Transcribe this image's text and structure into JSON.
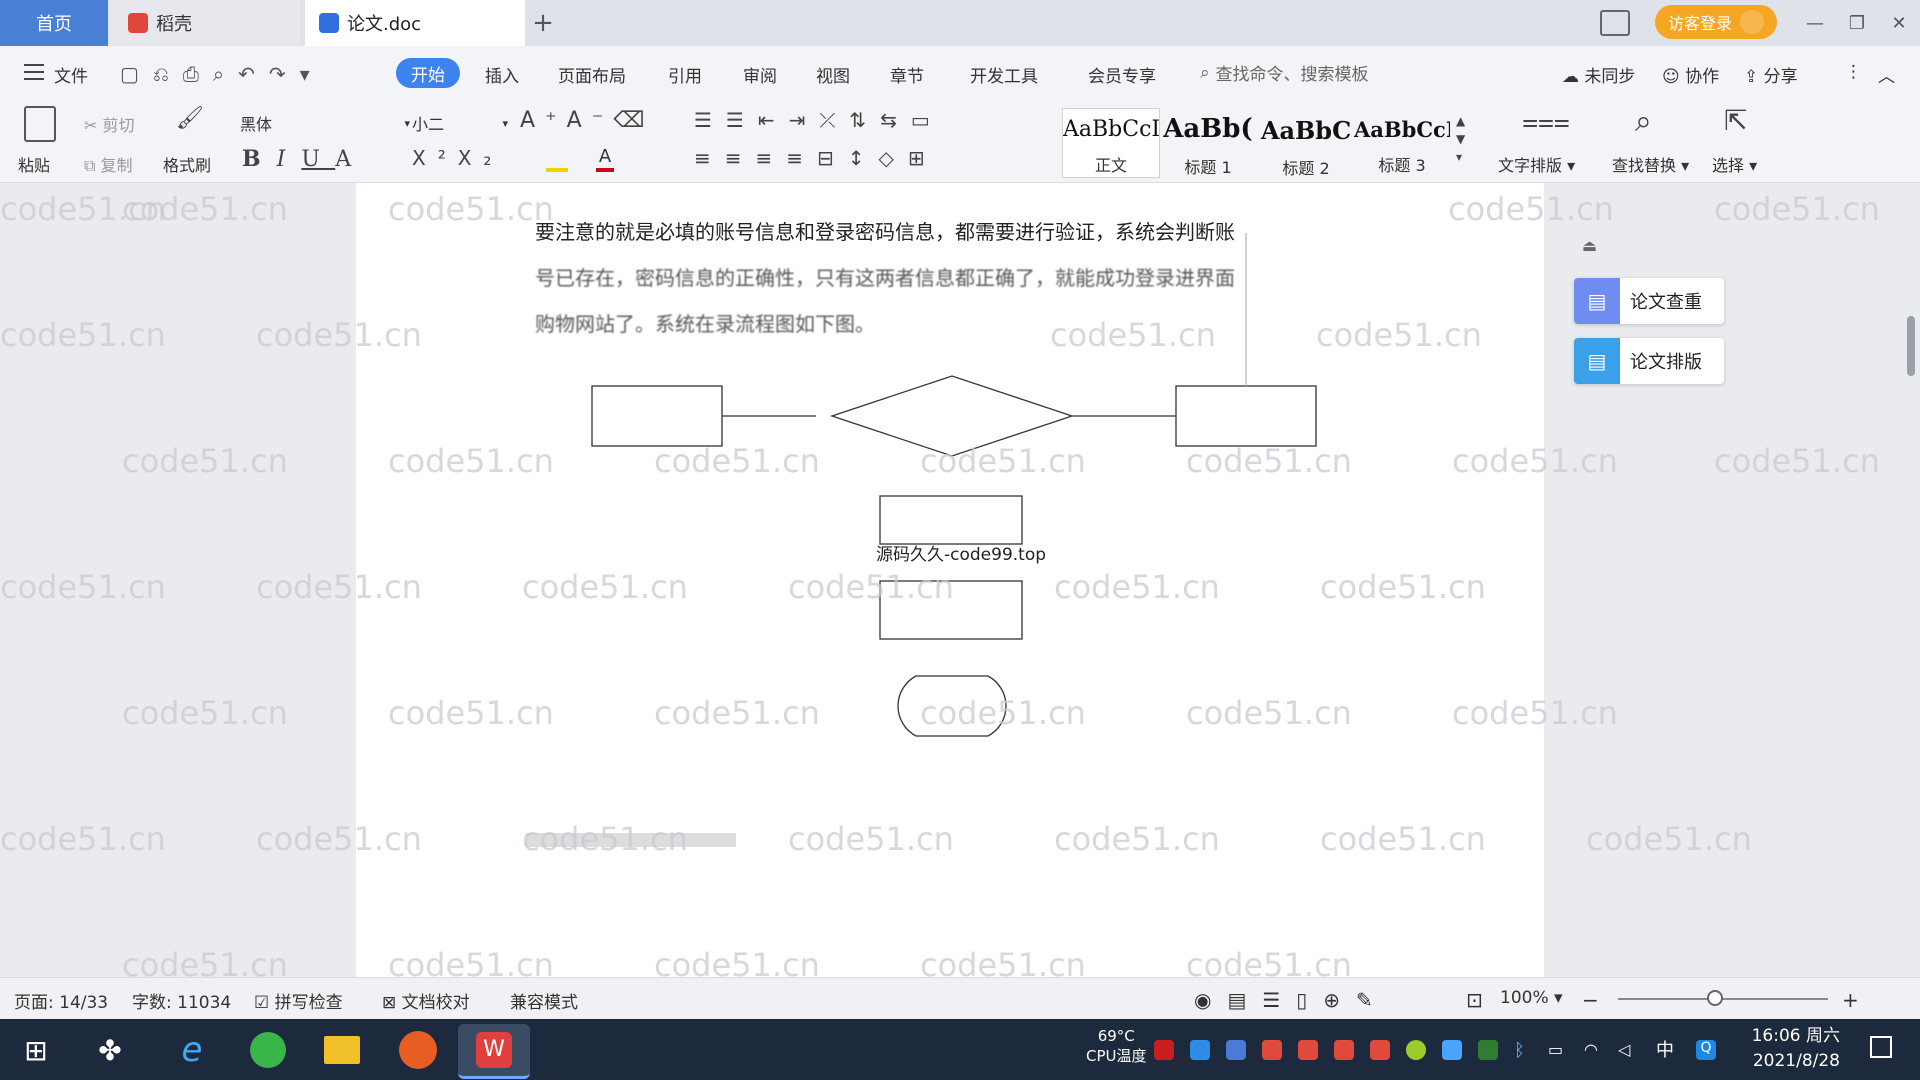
{
  "tabs": {
    "home": "首页",
    "daoke": "稻壳",
    "doc": "论文.doc",
    "add": "+"
  },
  "titlebar": {
    "login": "访客登录",
    "minimize": "—",
    "restore": "❐",
    "close": "✕"
  },
  "menu": {
    "file": "文件",
    "items": [
      "开始",
      "插入",
      "页面布局",
      "引用",
      "审阅",
      "视图",
      "章节",
      "开发工具",
      "会员专享"
    ],
    "search_placeholder": "查找命令、搜索模板",
    "sync": "未同步",
    "collab": "协作",
    "share": "分享"
  },
  "ribbon": {
    "paste": "粘贴",
    "cut": "剪切",
    "copy": "复制",
    "format_painter": "格式刷",
    "font_name": "黑体",
    "font_size": "小二",
    "styles": [
      {
        "preview": "AaBbCcI",
        "label": "正文"
      },
      {
        "preview": "AaBb(",
        "label": "标题 1"
      },
      {
        "preview": "AaBbC",
        "label": "标题 2"
      },
      {
        "preview": "AaBbCcI",
        "label": "标题 3"
      }
    ],
    "text_layout": "文字排版",
    "find_replace": "查找替换",
    "select": "选择"
  },
  "document": {
    "line1": "要注意的就是必填的账号信息和登录密码信息，都需要进行验证，系统会判断账",
    "line2": "号已存在，密码信息的正确性，只有这两者信息都正确了，就能成功登录进界面",
    "line3": "购物网站了。系统在录流程图如下图。",
    "caption": "源码久久-code99.top"
  },
  "watermark": "code51.cn",
  "side_panel": {
    "check": "论文查重",
    "format": "论文排版"
  },
  "status": {
    "page": "页面: 14/33",
    "words": "字数: 11034",
    "spell": "拼写检查",
    "proof": "文档校对",
    "compat": "兼容模式",
    "zoom": "100%"
  },
  "taskbar": {
    "temp": "69°C",
    "cpu": "CPU温度",
    "ime": "中",
    "time": "16:06 周六",
    "date": "2021/8/28"
  }
}
